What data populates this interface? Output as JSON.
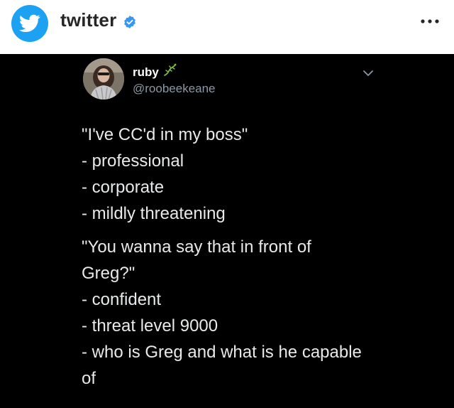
{
  "header": {
    "account_name": "twitter",
    "icons": {
      "avatar": "twitter-bird-icon",
      "verified": "verified-badge-icon",
      "more": "more-options-icon"
    },
    "brand_color": "#1da1f2"
  },
  "tweet": {
    "author_name": "ruby",
    "author_handle": "@roobeekeane",
    "icons": {
      "name_emoji": "lizard-icon",
      "menu": "chevron-down-icon"
    },
    "paragraphs": [
      [
        "\"I've CC'd in my boss\"",
        "- professional",
        "- corporate",
        "- mildly threatening"
      ],
      [
        "\"You wanna say that in front of",
        "Greg?\"",
        "- confident",
        "- threat level 9000",
        "- who is Greg and what is he capable",
        "of"
      ]
    ]
  }
}
